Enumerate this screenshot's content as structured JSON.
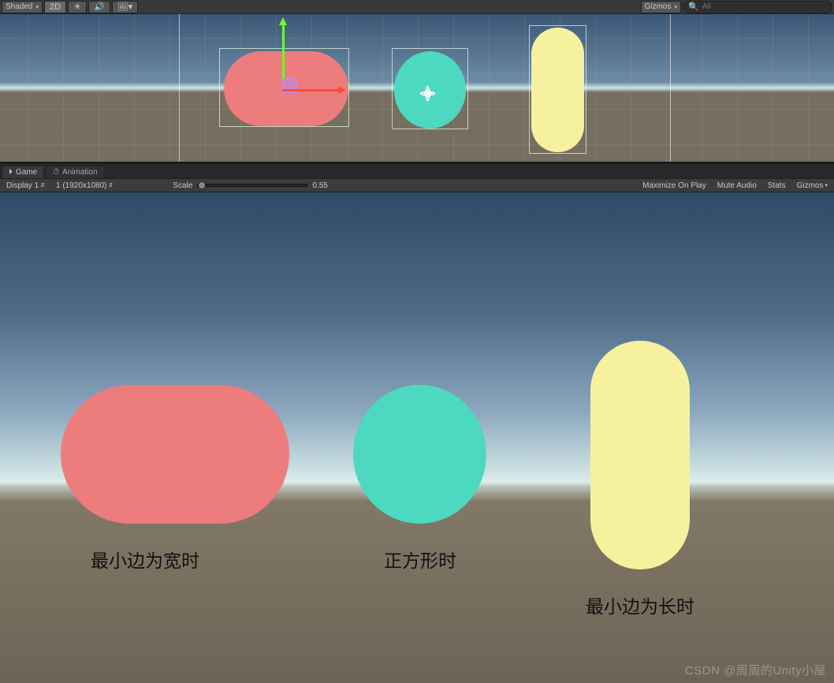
{
  "scene_toolbar": {
    "shading_mode": "Shaded",
    "view_mode": "2D",
    "gizmos_label": "Gizmos",
    "search_placeholder": "All"
  },
  "tabs": {
    "game": "Game",
    "animation": "Animation"
  },
  "game_toolbar": {
    "display": "Display 1",
    "resolution": "1 (1920x1080)",
    "scale_label": "Scale",
    "scale_value": "0.55",
    "maximize": "Maximize On Play",
    "mute": "Mute Audio",
    "stats": "Stats",
    "gizmos": "Gizmos"
  },
  "labels": {
    "wide": "最小边为宽时",
    "square": "正方形时",
    "tall": "最小边为长时"
  },
  "watermark": "CSDN @周周的Unity小屋",
  "icons": {
    "sun": "☀",
    "sound": "🔊",
    "picture": "🖼",
    "dropdown": "▾",
    "sort": "⇵",
    "search": "🔍",
    "game": "⏵",
    "clock": "⏱"
  }
}
